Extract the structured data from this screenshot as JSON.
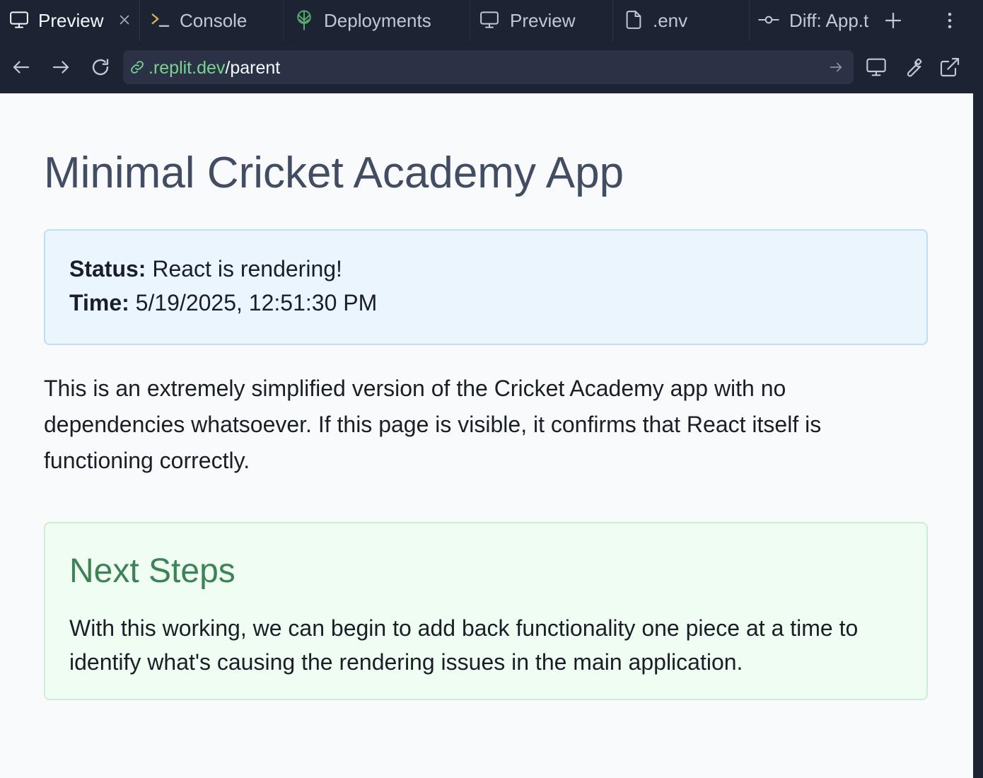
{
  "tabs": [
    {
      "label": "Preview",
      "icon": "monitor-icon",
      "active": true,
      "closable": true
    },
    {
      "label": "Console",
      "icon": "terminal-icon",
      "active": false
    },
    {
      "label": "Deployments",
      "icon": "deployments-icon",
      "active": false
    },
    {
      "label": "Preview",
      "icon": "monitor-icon",
      "active": false
    },
    {
      "label": ".env",
      "icon": "file-icon",
      "active": false
    },
    {
      "label": "Diff: App.t",
      "icon": "commit-icon",
      "active": false
    }
  ],
  "tabbar": {
    "add_icon": "plus-icon",
    "menu_icon": "more-vertical-icon"
  },
  "address_bar": {
    "url_host": ".replit.dev",
    "url_path": "/parent",
    "link_icon": "link-icon",
    "go_icon": "arrow-right-icon"
  },
  "toolbar_icons": [
    "back-arrow-icon",
    "forward-arrow-icon",
    "reload-icon",
    "device-icon",
    "devtools-wrench-icon",
    "open-external-icon"
  ],
  "page": {
    "title": "Minimal Cricket Academy App",
    "status_label": "Status:",
    "status_value": " React is rendering!",
    "time_label": "Time:",
    "time_value": " 5/19/2025, 12:51:30 PM",
    "intro": "This is an extremely simplified version of the Cricket Academy app with no dependencies whatsoever. If this page is visible, it confirms that React itself is functioning correctly.",
    "next_steps_title": "Next Steps",
    "next_steps_text": "With this working, we can begin to add back functionality one piece at a time to identify what's causing the rendering issues in the main application."
  },
  "colors": {
    "chrome_bg": "#1c2333",
    "url_bg": "#2b3245",
    "url_host": "#7ad28f",
    "page_bg": "#f8fafc",
    "title": "#424d63",
    "status_bg": "#ebf5fe",
    "status_border": "#bfdff5",
    "next_bg": "#f0fdf2",
    "next_border": "#cfedd6",
    "next_title": "#3e8257",
    "deploy_icon": "#58a86b"
  }
}
